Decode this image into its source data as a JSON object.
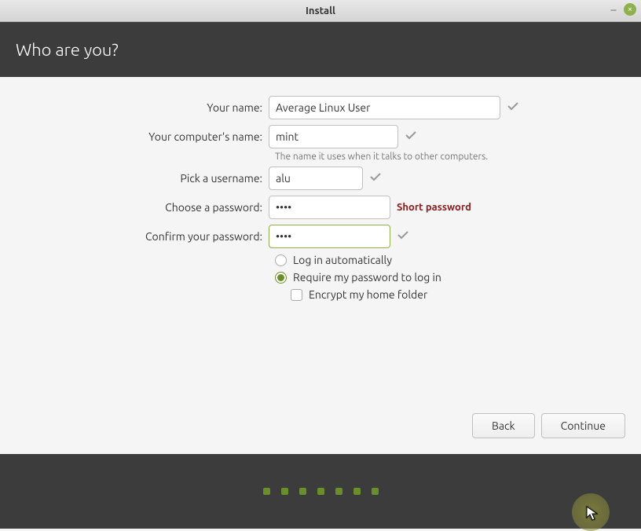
{
  "window": {
    "title": "Install"
  },
  "page": {
    "title": "Who are you?"
  },
  "form": {
    "name_label": "Your name:",
    "name_value": "Average Linux User",
    "host_label": "Your computer's name:",
    "host_value": "mint",
    "host_hint": "The name it uses when it talks to other computers.",
    "user_label": "Pick a username:",
    "user_value": "alu",
    "pwd_label": "Choose a password:",
    "pwd_value": "••••",
    "pwd_warn": "Short password",
    "pwd2_label": "Confirm your password:",
    "pwd2_value": "••••",
    "auto_login": "Log in automatically",
    "req_pwd": "Require my password to log in",
    "encrypt": "Encrypt my home folder"
  },
  "buttons": {
    "back": "Back",
    "continue": "Continue"
  }
}
